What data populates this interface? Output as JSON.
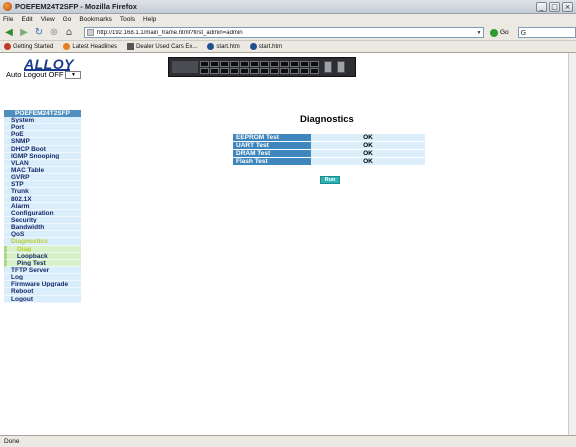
{
  "window": {
    "title": "POEFEM24T2SFP - Mozilla Firefox"
  },
  "menu": [
    "File",
    "Edit",
    "View",
    "Go",
    "Bookmarks",
    "Tools",
    "Help"
  ],
  "navigation": {
    "url": "http://192.168.1.1/main_frame.html?first_admin=admin",
    "go_label": "Go"
  },
  "bookmarks": [
    {
      "label": "Getting Started",
      "color": "#c0392b"
    },
    {
      "label": "Latest Headlines",
      "color": "#e67e22"
    },
    {
      "label": "Dealer Used Cars Ex...",
      "color": "#555555"
    },
    {
      "label": "start.htm",
      "color": "#1f4f8f"
    },
    {
      "label": "start.htm",
      "color": "#1f4f8f"
    }
  ],
  "header": {
    "logo_text": "ALLOY",
    "auto_logout_label": "Auto Logout",
    "auto_logout_value": "OFF"
  },
  "sidebar": {
    "title": "POEFEM24T2SFP",
    "items": [
      "System",
      "Port",
      "PoE",
      "SNMP",
      "DHCP Boot",
      "IGMP Snooping",
      "VLAN",
      "MAC Table",
      "GVRP",
      "STP",
      "Trunk",
      "802.1X",
      "Alarm",
      "Configuration",
      "Security",
      "Bandwidth",
      "QoS",
      "Diagnostics"
    ],
    "sub_items": [
      "Diag",
      "Loopback",
      "Ping Test"
    ],
    "items_after": [
      "TFTP Server",
      "Log",
      "Firmware Upgrade",
      "Reboot",
      "Logout"
    ]
  },
  "main": {
    "title": "Diagnostics",
    "tests": [
      {
        "name": "EEPROM Test",
        "result": "OK"
      },
      {
        "name": "UART Test",
        "result": "OK"
      },
      {
        "name": "DRAM Test",
        "result": "OK"
      },
      {
        "name": "Flash Test",
        "result": "OK"
      }
    ],
    "run_label": "Run"
  },
  "status": {
    "text": "Done"
  }
}
